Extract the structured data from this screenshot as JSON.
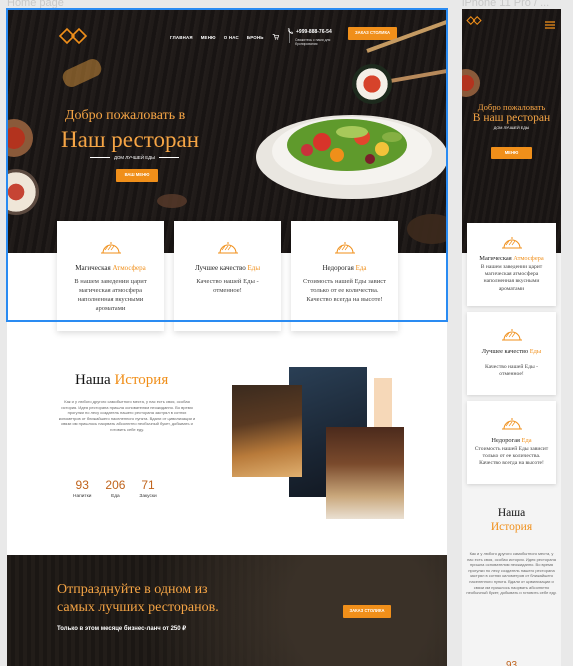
{
  "frames": {
    "desktop_label": "Home page",
    "mobile_label": "iPhone 11 Pro / ..."
  },
  "colors": {
    "accent": "#f08f1a",
    "accent_text": "#f6a545",
    "dark": "#1b1716",
    "selection": "#2a8bf2"
  },
  "desktop": {
    "nav": [
      "ГЛАВНАЯ",
      "МЕНЮ",
      "О НАС",
      "БРОНЬ"
    ],
    "cart_icon": "cart-icon",
    "phone": {
      "number": "+999-888-76-54",
      "note": "Свяжитесь с нами для бронирования"
    },
    "order_button": "ЗАКАЗ СТОЛИКА",
    "hero": {
      "line1": "Добро пожаловать в",
      "line2": "Наш ресторан",
      "subtitle": "ДОМ ЛУЧШЕЙ ЕДЫ",
      "button": "ВАШ МЕНЮ"
    },
    "features": [
      {
        "title": "Магическая",
        "accent": "Атмосфера",
        "text": "В нашем заведении царит магическая атмосфера наполненная вкусными ароматами"
      },
      {
        "title": "Лучшее качество",
        "accent": "Еды",
        "text": "Качество нашей Еды - отменное!"
      },
      {
        "title": "Недорогая",
        "accent": "Еда",
        "text": "Стоимость нашей Еды завист только от ее количества. Качество всегда на высоте!"
      }
    ],
    "history": {
      "title": "Наша",
      "accent": "История",
      "text": "Как и у любого другого самобытного места, у нас есть своя, особая история. Идея ресторана пришла основателям неожиданно. Во время прогулки по лесу создатель нашего ресторана застрял в сотнях километров от ближайшего населенного пункта. Вдали от цивилизации и связи им пришлось наорвать абсолютно необычный букет, добывать и готовить себе еду.",
      "stats": [
        {
          "value": "93",
          "label": "Напитки"
        },
        {
          "value": "206",
          "label": "Еда"
        },
        {
          "value": "71",
          "label": "Закуски"
        }
      ]
    },
    "cta": {
      "line1": "Отпразднуйте в одном из",
      "line2": "самых лучших ресторанов.",
      "sub": "Только в этом месяце бизнес-ланч от 250 ₽",
      "button": "ЗАКАЗ СТОЛИКА"
    }
  },
  "mobile": {
    "hero": {
      "line1": "Добро пожаловать",
      "line2": "В наш ресторан",
      "subtitle": "ДОМ ЛУЧШЕЙ ЕДЫ",
      "button": "МЕНЮ"
    },
    "features": [
      {
        "title": "Магическая",
        "accent": "Атмосфера",
        "text": "В нашем заведении царит магическая атмосфера наполненная вкусными ароматами"
      },
      {
        "title": "Лучшее качество",
        "accent": "Еды",
        "text": "Качество нашей Еды - отменное!"
      },
      {
        "title": "Недорогая",
        "accent": "Еда",
        "text": "Стоимость нашей Еды зависит только от ее количества. Качество всегда на высоте!"
      }
    ],
    "history": {
      "title": "Наша",
      "accent": "История",
      "text": "Как и у любого другого самобытного места, у нас есть своя, особая история. Идея ресторана пришла основателям неожиданно. Во время прогулки по лесу создатель нашего ресторана застрял в сотнях километров от ближайшего населенного пункта. Вдали от цивилизации и связи им пришлось наорвать абсолютно необычный букет, добывать и готовить себе еду.",
      "stat": "93"
    }
  }
}
